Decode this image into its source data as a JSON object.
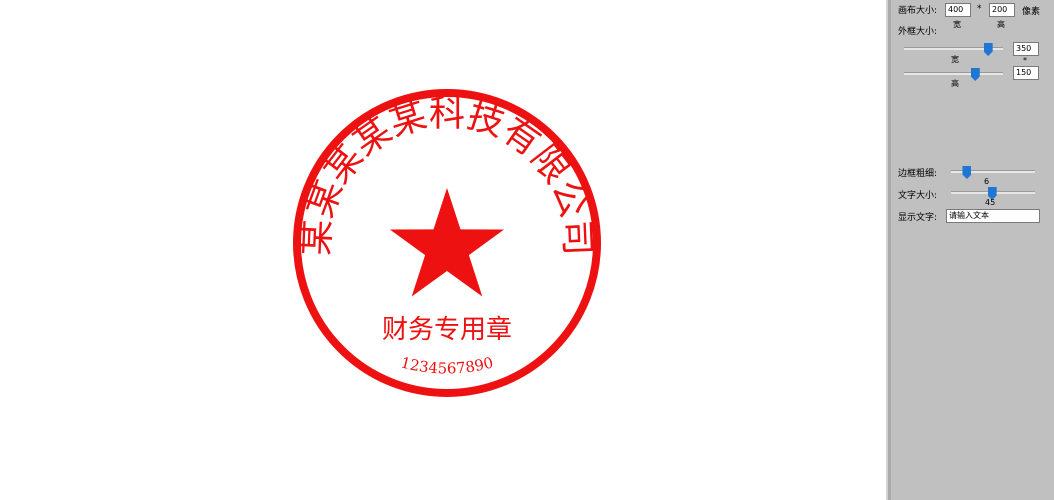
{
  "stamp": {
    "color": "#ee1111",
    "arc_text": "某某某某某科技有限公司",
    "center_text": "财务专用章",
    "serial_text": "1234567890",
    "star_icon": "star-icon"
  },
  "panel": {
    "canvas_label": "画布大小:",
    "canvas_width": "400",
    "canvas_height": "200",
    "times_sign": "*",
    "unit_label": "像素",
    "width_label": "宽",
    "height_label": "高",
    "frame_label": "外框大小:",
    "frame_width": "350",
    "frame_height": "150",
    "frame_width_slider_label": "宽",
    "frame_height_slider_label": "高",
    "frame_times_sign": "*",
    "frame_width_level": 0.85,
    "frame_height_level": 0.72,
    "border_label": "边框粗细:",
    "border_value": "6",
    "border_level": 0.19,
    "font_size_label": "文字大小:",
    "font_size_value": "45",
    "font_size_level": 0.49,
    "display_text_label": "显示文字:",
    "display_text_placeholder": "请输入文本"
  }
}
